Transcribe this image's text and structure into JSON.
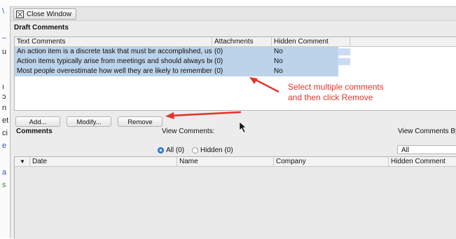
{
  "window": {
    "close_label": "Close Window"
  },
  "draft": {
    "title": "Draft Comments",
    "columns": [
      "Text Comments",
      "Attachments",
      "Hidden Comment"
    ],
    "rows": [
      {
        "text": "An action item is a discrete task that must be accomplished, usua",
        "attachments": "(0)",
        "hidden": "No"
      },
      {
        "text": "Action items typically arise from meetings and should always be c",
        "attachments": "(0)",
        "hidden": "No"
      },
      {
        "text": "Most people overestimate how well they are likely to remember th",
        "attachments": "(0)",
        "hidden": "No"
      }
    ]
  },
  "buttons": {
    "add": "Add...",
    "modify": "Modify...",
    "remove": "Remove"
  },
  "annotation": {
    "line1": "Select multiple comments",
    "line2": "and then click Remove",
    "color": "#e2352b"
  },
  "comments": {
    "title": "Comments",
    "view_label": "View Comments:",
    "view_by_label": "View Comments By",
    "radio_all": "All (0)",
    "radio_hidden": "Hidden (0)",
    "view_by_value": "All",
    "columns": [
      "Date",
      "Name",
      "Company",
      "Hidden Comment"
    ]
  },
  "colors": {
    "selection": "#bcd3ea",
    "accent": "#2e7fe0"
  }
}
